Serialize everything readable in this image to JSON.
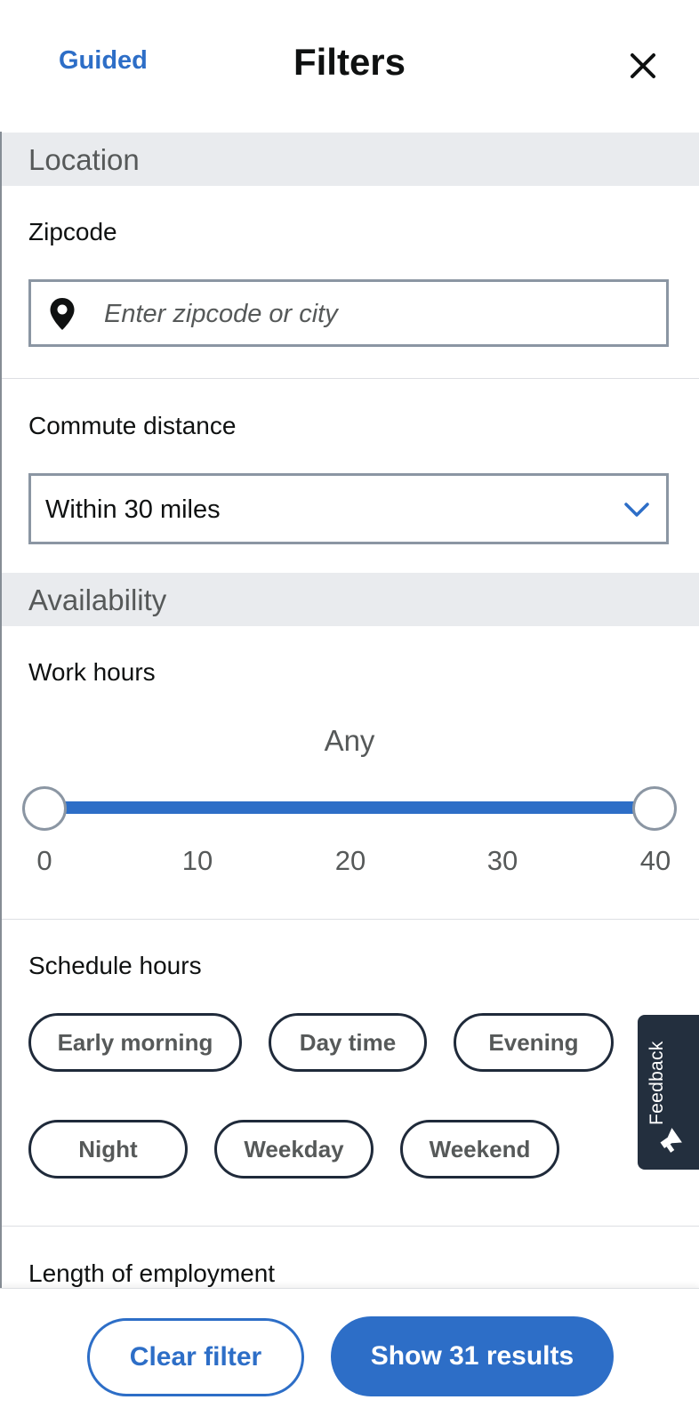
{
  "header": {
    "guided_label": "Guided",
    "title": "Filters"
  },
  "sections": {
    "location": "Location",
    "availability": "Availability"
  },
  "zipcode": {
    "label": "Zipcode",
    "placeholder": "Enter zipcode or city",
    "value": ""
  },
  "commute": {
    "label": "Commute distance",
    "selected": "Within 30 miles"
  },
  "work_hours": {
    "label": "Work hours",
    "value_text": "Any",
    "range_min": 0,
    "range_max": 40,
    "selected_min": 0,
    "selected_max": 40,
    "ticks": [
      "0",
      "10",
      "20",
      "30",
      "40"
    ]
  },
  "schedule": {
    "label": "Schedule hours",
    "chips": [
      "Early morning",
      "Day time",
      "Evening",
      "Night",
      "Weekday",
      "Weekend"
    ]
  },
  "length_label": "Length of employment",
  "feedback_label": "Feedback",
  "footer": {
    "clear_label": "Clear filter",
    "show_label": "Show 31 results"
  },
  "colors": {
    "accent": "#2d6ec7",
    "dark": "#232f3e",
    "section_bg": "#e9ebee",
    "border": "#8b96a3"
  },
  "icons": {
    "close": "close-icon",
    "pin": "location-pin-icon",
    "chevron": "chevron-down-icon",
    "feedback": "megaphone-icon"
  }
}
